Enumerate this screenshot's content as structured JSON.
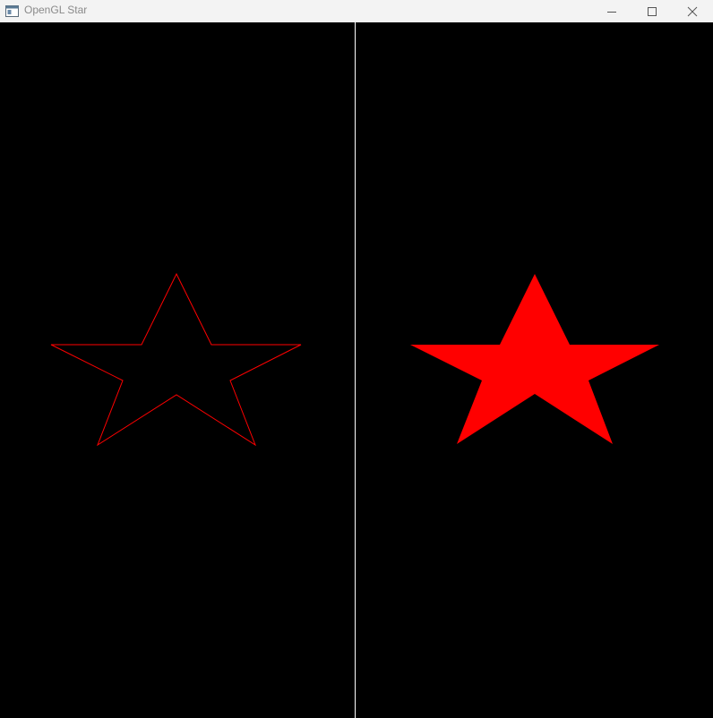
{
  "window": {
    "title": "OpenGL Star",
    "icons": {
      "app": "app-window-icon",
      "minimize": "minimize-icon",
      "maximize": "maximize-icon",
      "close": "close-icon"
    }
  },
  "scene": {
    "background_color": "#000000",
    "divider_color": "#ffffff",
    "left_panel": {
      "shape": "star-outline",
      "color": "#ff0000"
    },
    "right_panel": {
      "shape": "star-filled",
      "color": "#ff0000"
    }
  }
}
